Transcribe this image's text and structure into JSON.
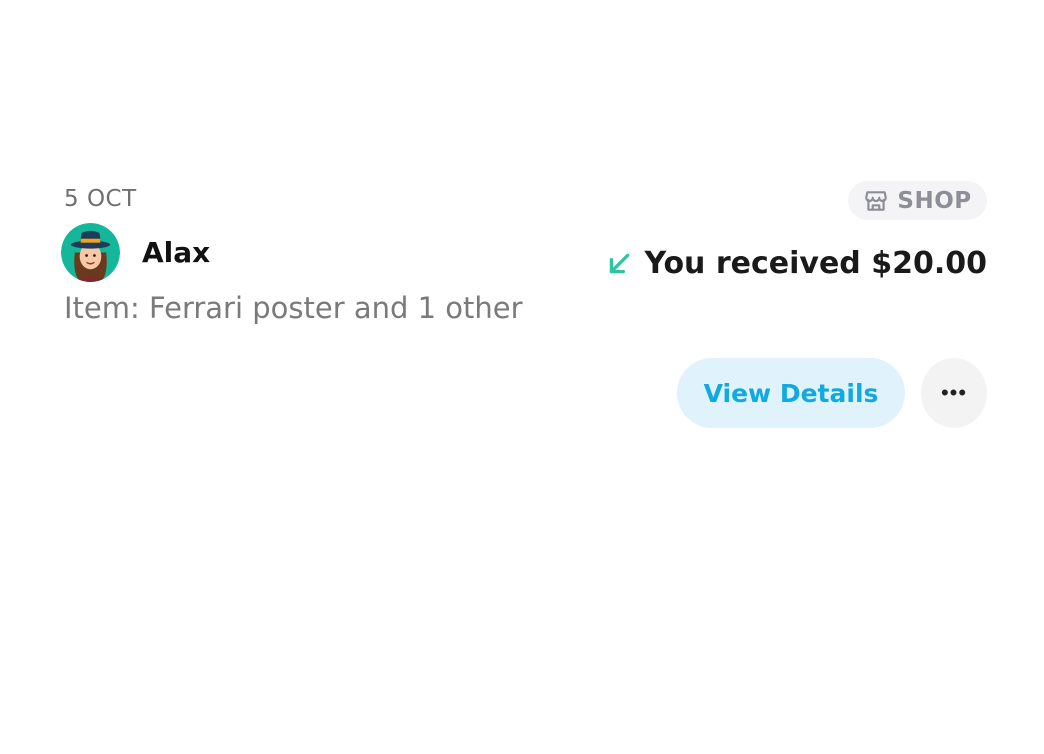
{
  "transaction": {
    "date": "5 OCT",
    "category_label": "SHOP",
    "category_icon": "storefront-icon",
    "user_name": "Alax",
    "item_text": "Item: Ferrari poster and 1 other",
    "direction_icon": "arrow-down-left-icon",
    "received_text": "You received $20.00",
    "view_details_label": "View Details",
    "more_icon": "ellipsis-icon",
    "more_label": "•••"
  },
  "colors": {
    "accent": "#12a9e0",
    "accent_bg": "#e0f2fc",
    "received_arrow": "#2ec4a0",
    "badge_bg": "#f4f4f6",
    "badge_text": "#8e8e98"
  }
}
